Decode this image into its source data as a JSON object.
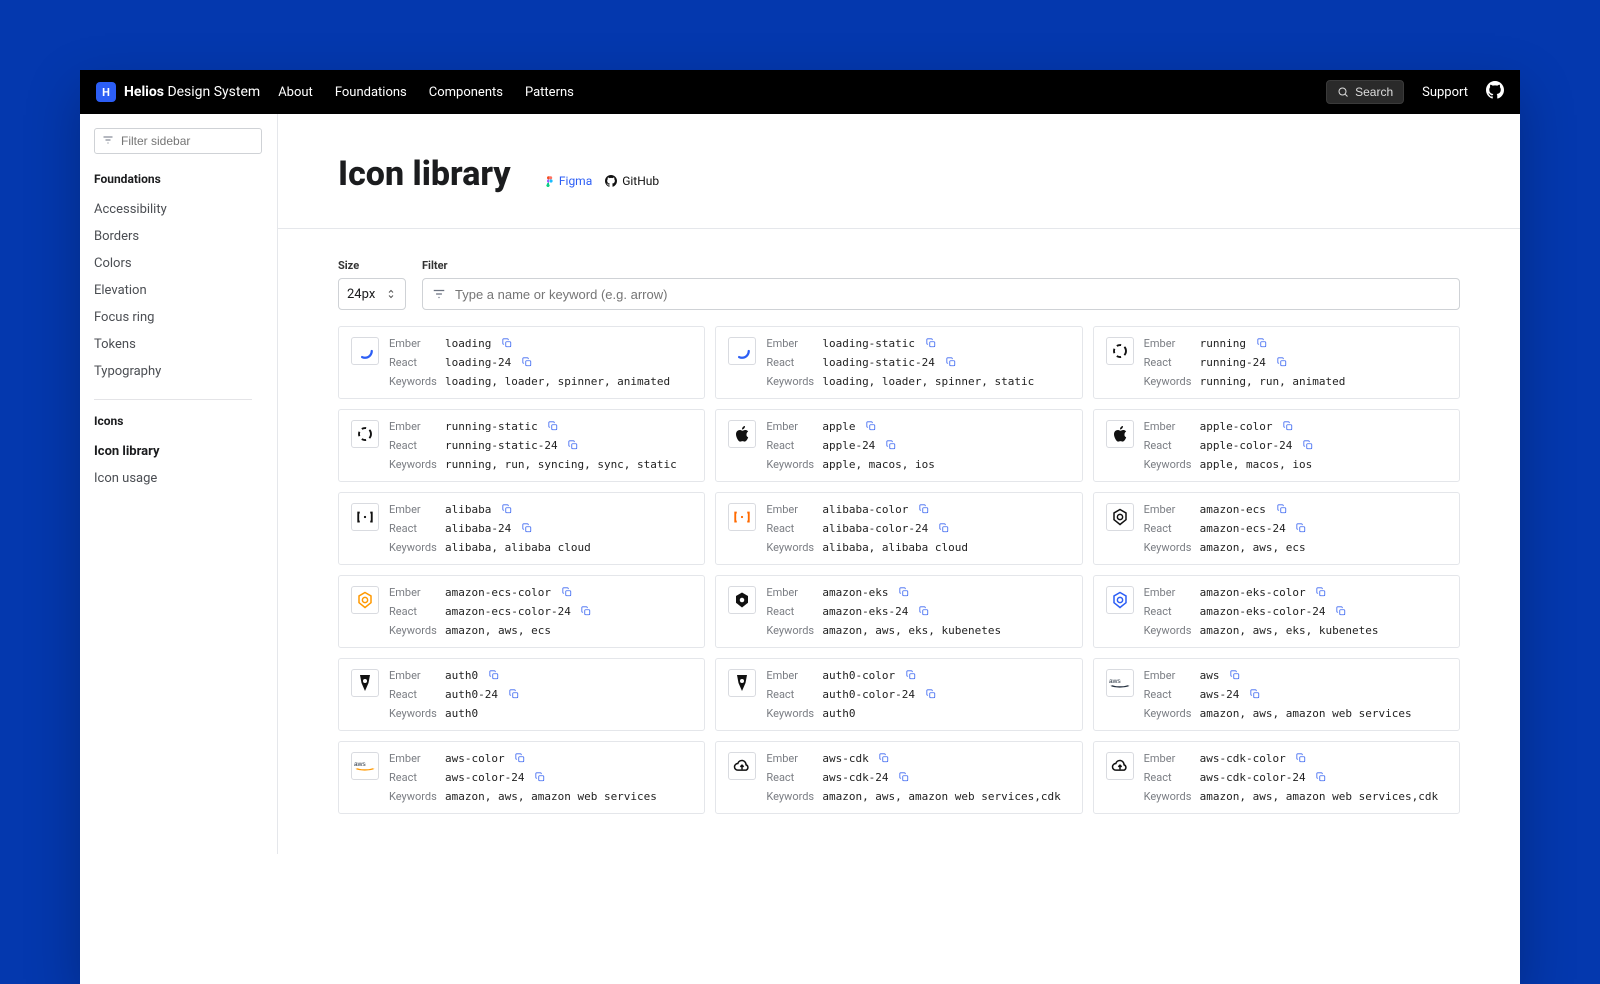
{
  "brand": {
    "strong": "Helios",
    "rest": "Design System"
  },
  "nav": [
    "About",
    "Foundations",
    "Components",
    "Patterns"
  ],
  "topbar": {
    "search": "Search",
    "support": "Support"
  },
  "sidebar": {
    "filter_placeholder": "Filter sidebar",
    "groups": [
      {
        "heading": "Foundations",
        "items": [
          "Accessibility",
          "Borders",
          "Colors",
          "Elevation",
          "Focus ring",
          "Tokens",
          "Typography"
        ]
      },
      {
        "heading": "Icons",
        "items": [
          "Icon library",
          "Icon usage"
        ],
        "active": "Icon library"
      }
    ]
  },
  "page": {
    "title": "Icon library",
    "figma": "Figma",
    "github": "GitHub"
  },
  "controls": {
    "size_label": "Size",
    "size_value": "24px",
    "filter_label": "Filter",
    "filter_placeholder": "Type a name or keyword (e.g. arrow)"
  },
  "row_labels": {
    "ember": "Ember",
    "react": "React",
    "keywords": "Keywords"
  },
  "icons": [
    {
      "thumb": "spinner",
      "ember": "loading",
      "react": "loading-24",
      "keywords": "loading, loader, spinner, animated"
    },
    {
      "thumb": "spinner",
      "ember": "loading-static",
      "react": "loading-static-24",
      "keywords": "loading, loader, spinner, static"
    },
    {
      "thumb": "ring",
      "ember": "running",
      "react": "running-24",
      "keywords": "running, run, animated"
    },
    {
      "thumb": "ring",
      "ember": "running-static",
      "react": "running-static-24",
      "keywords": "running, run, syncing, sync, static"
    },
    {
      "thumb": "apple",
      "ember": "apple",
      "react": "apple-24",
      "keywords": "apple, macos, ios"
    },
    {
      "thumb": "apple",
      "ember": "apple-color",
      "react": "apple-color-24",
      "keywords": "apple, macos, ios"
    },
    {
      "thumb": "bracket",
      "ember": "alibaba",
      "react": "alibaba-24",
      "keywords": "alibaba, alibaba cloud"
    },
    {
      "thumb": "bracket-o",
      "ember": "alibaba-color",
      "react": "alibaba-color-24",
      "keywords": "alibaba, alibaba cloud"
    },
    {
      "thumb": "hex",
      "ember": "amazon-ecs",
      "react": "amazon-ecs-24",
      "keywords": "amazon, aws, ecs"
    },
    {
      "thumb": "hex-o",
      "ember": "amazon-ecs-color",
      "react": "amazon-ecs-color-24",
      "keywords": "amazon, aws, ecs"
    },
    {
      "thumb": "hexd",
      "ember": "amazon-eks",
      "react": "amazon-eks-24",
      "keywords": "amazon, aws, eks, kubenetes"
    },
    {
      "thumb": "hexd-b",
      "ember": "amazon-eks-color",
      "react": "amazon-eks-color-24",
      "keywords": "amazon, aws, eks, kubenetes"
    },
    {
      "thumb": "shield",
      "ember": "auth0",
      "react": "auth0-24",
      "keywords": "auth0"
    },
    {
      "thumb": "shield",
      "ember": "auth0-color",
      "react": "auth0-color-24",
      "keywords": "auth0"
    },
    {
      "thumb": "aws",
      "ember": "aws",
      "react": "aws-24",
      "keywords": "amazon, aws, amazon web services"
    },
    {
      "thumb": "aws-o",
      "ember": "aws-color",
      "react": "aws-color-24",
      "keywords": "amazon, aws, amazon web services"
    },
    {
      "thumb": "cloud",
      "ember": "aws-cdk",
      "react": "aws-cdk-24",
      "keywords": "amazon, aws, amazon web services,cdk"
    },
    {
      "thumb": "cloud",
      "ember": "aws-cdk-color",
      "react": "aws-cdk-color-24",
      "keywords": "amazon, aws, amazon web services,cdk"
    }
  ]
}
